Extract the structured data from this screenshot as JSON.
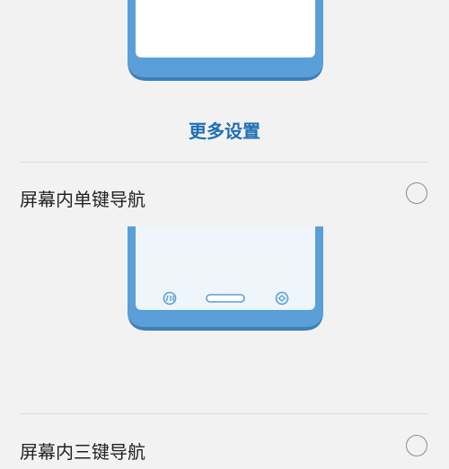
{
  "more_settings_label": "更多设置",
  "options": [
    {
      "label": "屏幕内单键导航",
      "selected": false
    },
    {
      "label": "屏幕内三键导航",
      "selected": false
    }
  ],
  "colors": {
    "phone_frame": "#5b9fd8",
    "phone_frame_shadow": "#3f7fb8",
    "accent_link": "#1f6fb5",
    "background": "#f2f2f2"
  }
}
